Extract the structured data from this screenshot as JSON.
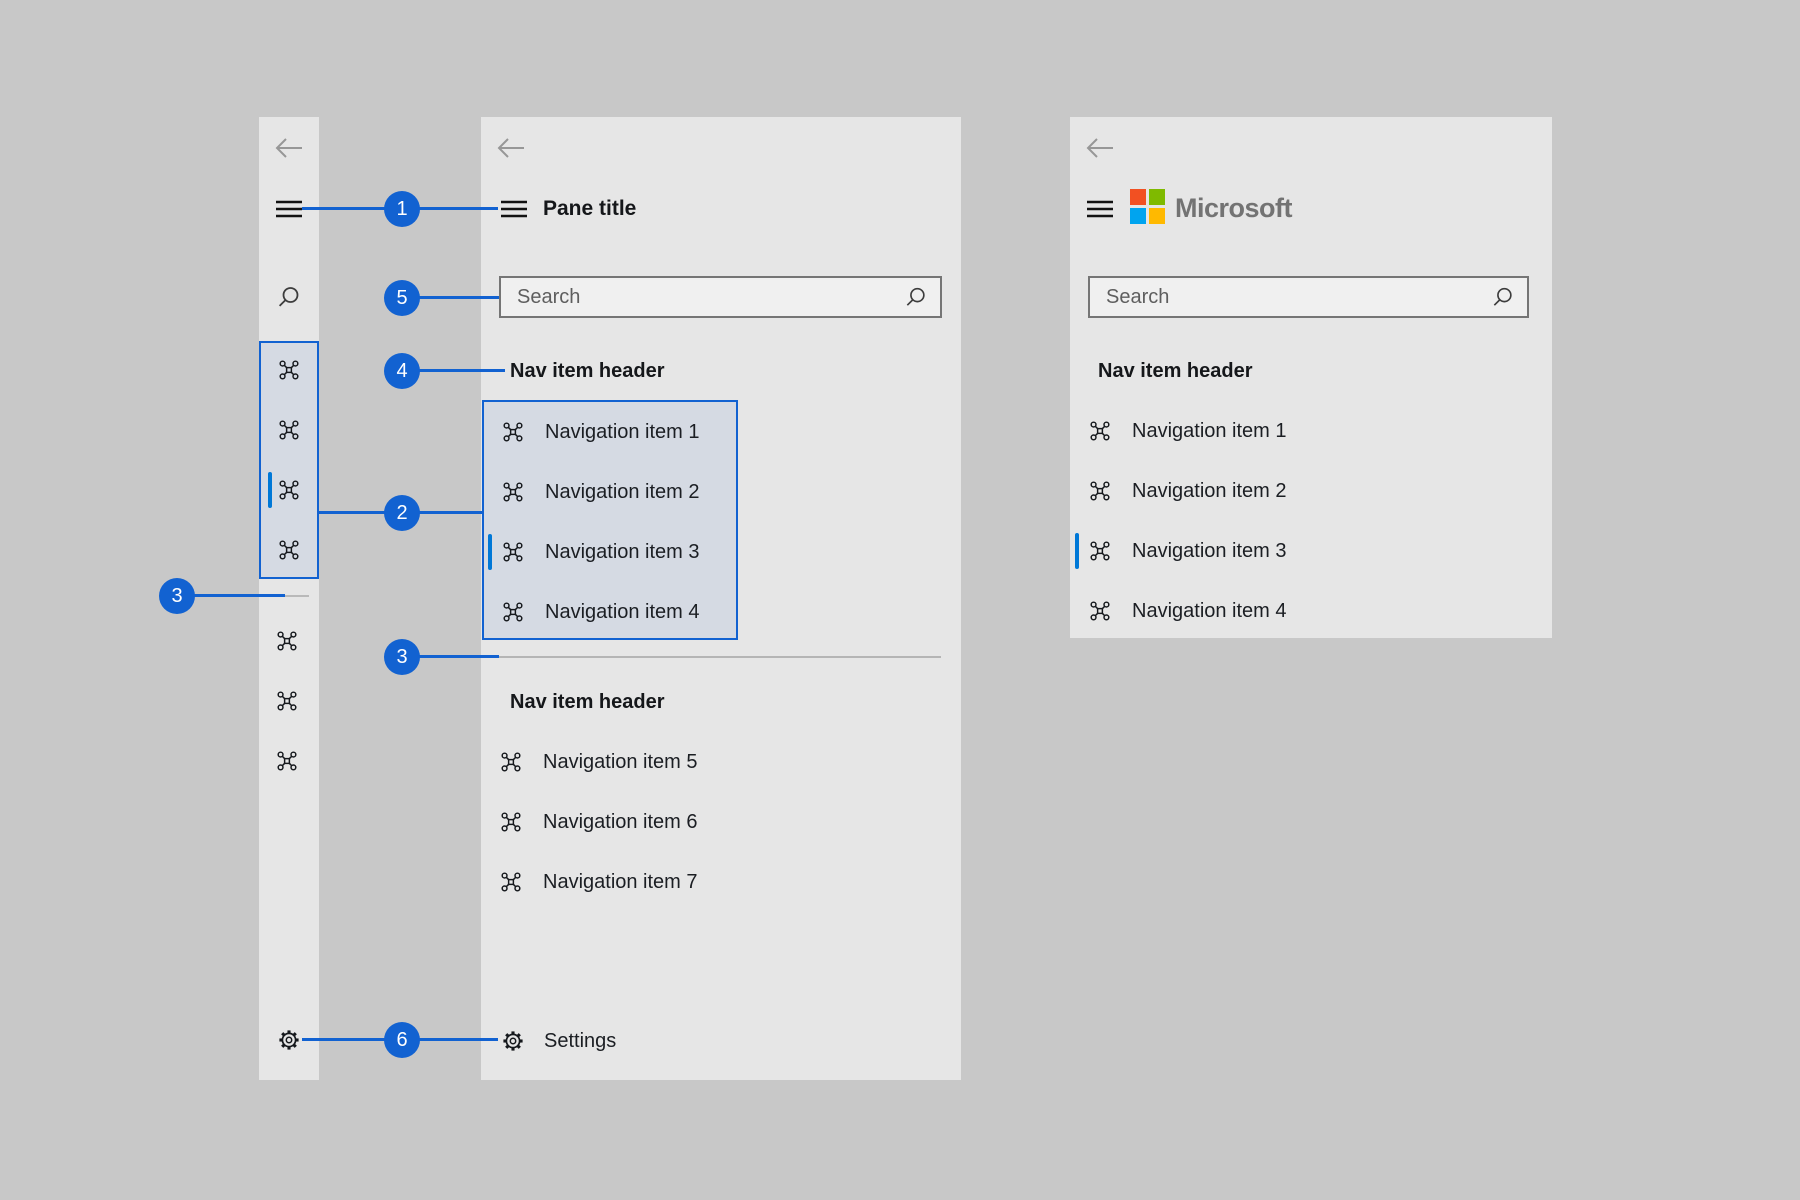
{
  "colors": {
    "annotation_accent": "#1262d1",
    "selection_indicator": "#0078d7",
    "highlight_fill": "#d5dae3",
    "pane_background": "#e6e6e6",
    "page_background": "#c8c8c8",
    "ms_logo_red": "#f25022",
    "ms_logo_green": "#7fba00",
    "ms_logo_blue": "#00a4ef",
    "ms_logo_yellow": "#ffb900"
  },
  "icons": {
    "back": "back-arrow-icon",
    "menu": "hamburger-icon",
    "search": "magnifier-icon",
    "nav_item": "placeholder-icon",
    "settings": "gear-icon",
    "logo": "microsoft-logo"
  },
  "compact_pane": {
    "nav_item_count_top": 4,
    "nav_item_count_bottom": 3,
    "selected_item_index": 3
  },
  "middle": {
    "title": "Pane title",
    "search_placeholder": "Search",
    "sections": [
      {
        "header": "Nav item header",
        "items": [
          {
            "label": "Navigation item 1"
          },
          {
            "label": "Navigation item 2"
          },
          {
            "label": "Navigation item 3"
          },
          {
            "label": "Navigation item 4"
          }
        ]
      },
      {
        "header": "Nav item header",
        "items": [
          {
            "label": "Navigation item 5"
          },
          {
            "label": "Navigation item 6"
          },
          {
            "label": "Navigation item 7"
          }
        ]
      }
    ],
    "selected_item": "Navigation item 3",
    "settings_label": "Settings"
  },
  "right": {
    "brand": "Microsoft",
    "search_placeholder": "Search",
    "section": {
      "header": "Nav item header",
      "items": [
        {
          "label": "Navigation item 1"
        },
        {
          "label": "Navigation item 2"
        },
        {
          "label": "Navigation item 3"
        },
        {
          "label": "Navigation item 4"
        }
      ]
    },
    "selected_item": "Navigation item 3"
  },
  "annotations": {
    "badges": [
      {
        "num": "1"
      },
      {
        "num": "5"
      },
      {
        "num": "4"
      },
      {
        "num": "2"
      },
      {
        "num": "3"
      },
      {
        "num": "3"
      },
      {
        "num": "6"
      }
    ]
  }
}
